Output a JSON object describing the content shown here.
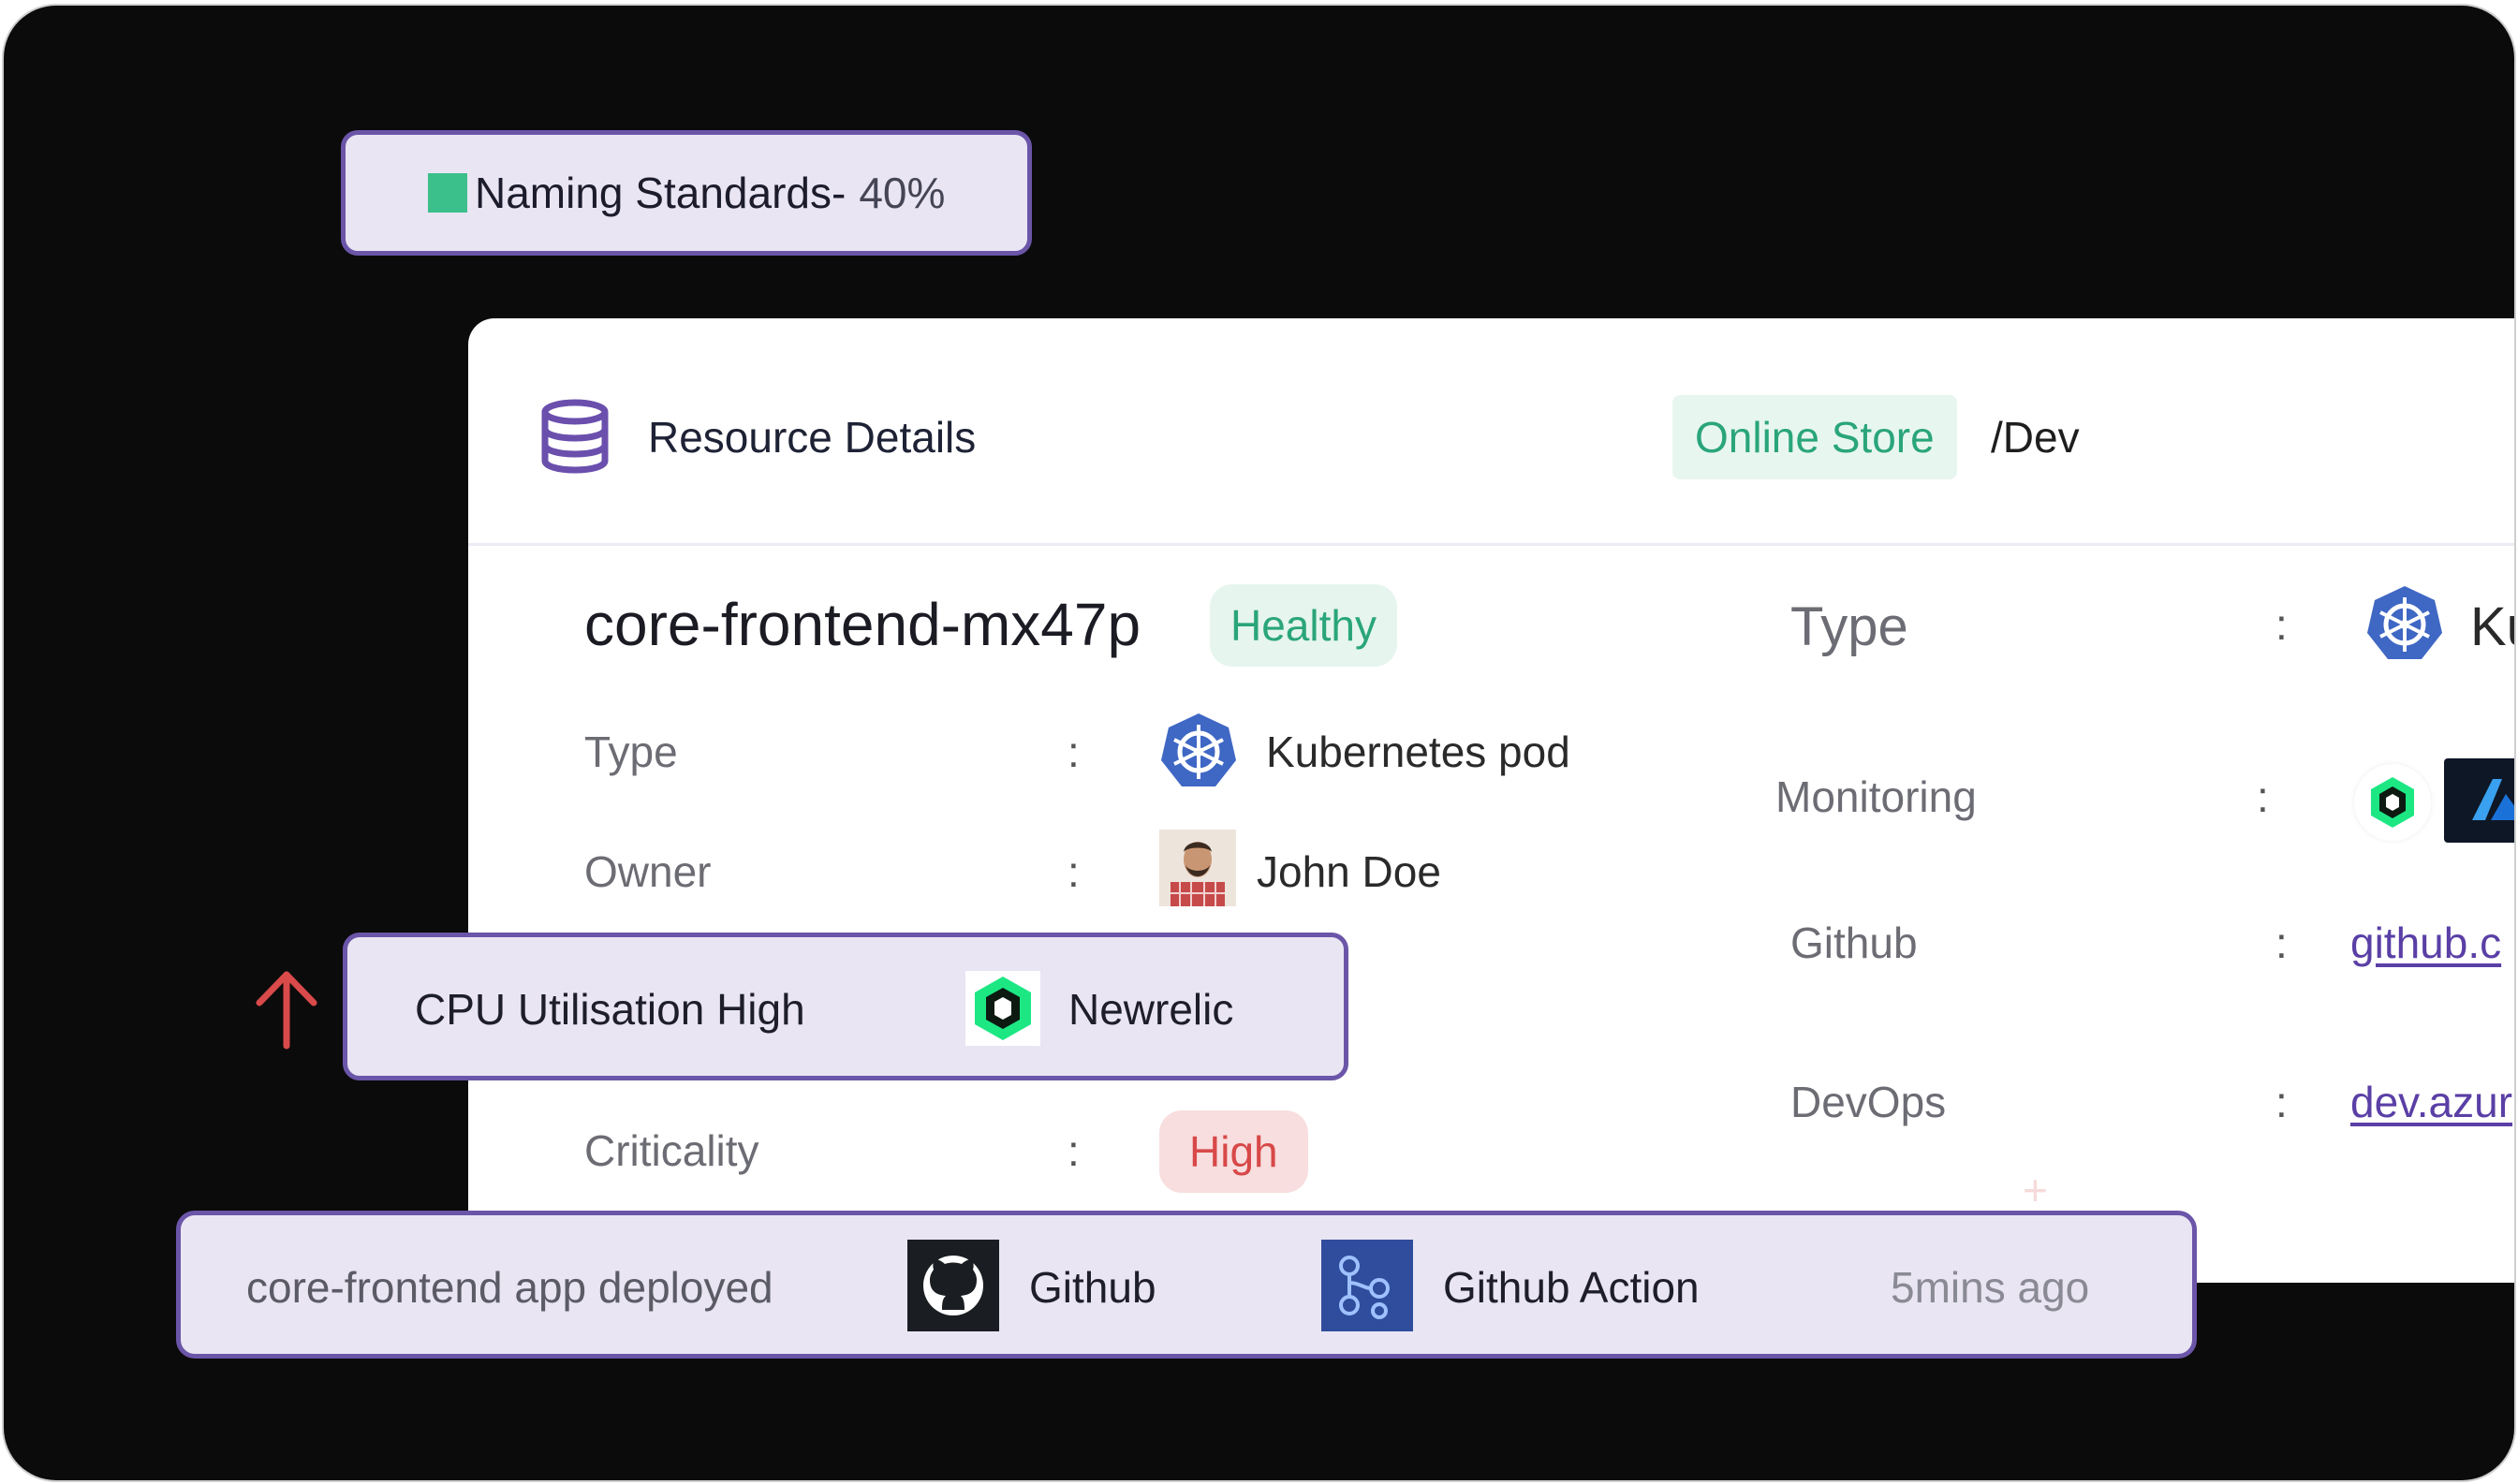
{
  "naming": {
    "label": "Naming Standards-",
    "percent": "40%",
    "swatch_color": "#3bbf8b"
  },
  "card": {
    "title": "Resource Details",
    "app_tag": "Online Store",
    "environment": "/Dev",
    "resource_name": "core-frontend-mx47p",
    "status": "Healthy",
    "left_fields": [
      {
        "label": "Type",
        "value": "Kubernetes pod",
        "icon": "kubernetes-icon"
      },
      {
        "label": "Owner",
        "value": "John Doe",
        "icon": "avatar"
      },
      {
        "label": "Criticality",
        "value": "High"
      }
    ],
    "right_fields": [
      {
        "label": "Type",
        "value": "Ku",
        "icon": "kubernetes-icon"
      },
      {
        "label": "Monitoring",
        "icons": [
          "newrelic-icon",
          "azure-icon"
        ]
      },
      {
        "label": "Github",
        "value": "github.c"
      },
      {
        "label": "DevOps",
        "value": "dev.azur"
      }
    ],
    "colon": ":"
  },
  "cpu_alert": {
    "text": "CPU Utilisation High",
    "source": "Newrelic",
    "arrow_color": "#d94a4a"
  },
  "deploy": {
    "text": "core-frontend app deployed",
    "source": "Github",
    "action": "Github Action",
    "time": "5mins ago"
  },
  "colors": {
    "accent_border": "#6b55a8",
    "pill_bg": "#e9e5f3",
    "healthy": "#2aa57b",
    "critical": "#d84848",
    "link": "#5a3fa6"
  }
}
